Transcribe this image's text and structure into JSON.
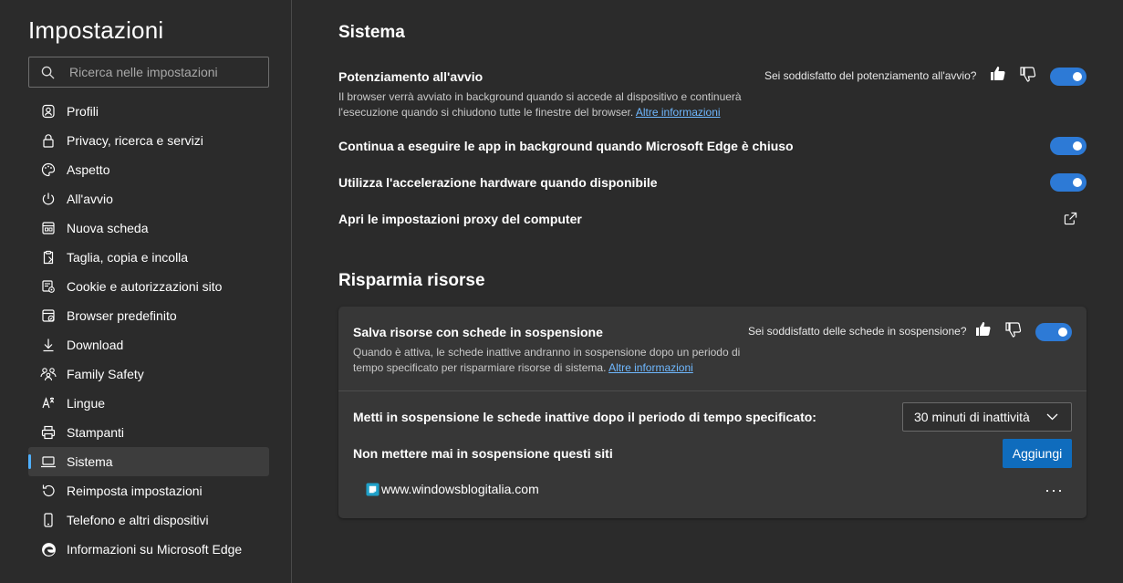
{
  "sidebar": {
    "title": "Impostazioni",
    "search_placeholder": "Ricerca nelle impostazioni",
    "items": [
      {
        "label": "Profili",
        "icon": "profile-icon"
      },
      {
        "label": "Privacy, ricerca e servizi",
        "icon": "lock-icon"
      },
      {
        "label": "Aspetto",
        "icon": "palette-icon"
      },
      {
        "label": "All'avvio",
        "icon": "power-icon"
      },
      {
        "label": "Nuova scheda",
        "icon": "new-tab-icon"
      },
      {
        "label": "Taglia, copia e incolla",
        "icon": "clipboard-icon"
      },
      {
        "label": "Cookie e autorizzazioni sito",
        "icon": "cookie-permissions-icon"
      },
      {
        "label": "Browser predefinito",
        "icon": "default-browser-icon"
      },
      {
        "label": "Download",
        "icon": "download-icon"
      },
      {
        "label": "Family Safety",
        "icon": "family-icon"
      },
      {
        "label": "Lingue",
        "icon": "language-icon"
      },
      {
        "label": "Stampanti",
        "icon": "printer-icon"
      },
      {
        "label": "Sistema",
        "icon": "laptop-icon",
        "active": true
      },
      {
        "label": "Reimposta impostazioni",
        "icon": "reset-icon"
      },
      {
        "label": "Telefono e altri dispositivi",
        "icon": "phone-icon"
      },
      {
        "label": "Informazioni su Microsoft Edge",
        "icon": "edge-icon"
      }
    ]
  },
  "system": {
    "heading": "Sistema",
    "startup_boost": {
      "title": "Potenziamento all'avvio",
      "desc1": "Il browser verrà avviato in background quando si accede al dispositivo e continuerà",
      "desc2": "l'esecuzione quando si chiudono tutte le finestre del browser.",
      "link": "Altre informazioni",
      "feedback": "Sei soddisfatto del potenziamento all'avvio?",
      "enabled": true
    },
    "background_apps": {
      "title": "Continua a eseguire le app in background quando Microsoft Edge è chiuso",
      "enabled": true
    },
    "hardware_accel": {
      "title": "Utilizza l'accelerazione hardware quando disponibile",
      "enabled": true
    },
    "proxy": {
      "title": "Apri le impostazioni proxy del computer"
    }
  },
  "resources": {
    "heading": "Risparmia risorse",
    "sleeping_tabs": {
      "title": "Salva risorse con schede in sospensione",
      "desc1": "Quando è attiva, le schede inattive andranno in sospensione dopo un periodo di",
      "desc2": "tempo specificato per risparmiare risorse di sistema.",
      "link": "Altre informazioni",
      "feedback": "Sei soddisfatto delle schede in sospensione?",
      "enabled": true
    },
    "sleep_after": {
      "label": "Metti in sospensione le schede inattive dopo il periodo di tempo specificato:",
      "selected": "30 minuti di inattività"
    },
    "never_sleep": {
      "label": "Non mettere mai in sospensione questi siti",
      "add_button": "Aggiungi"
    },
    "sites": [
      {
        "url": "www.windowsblogitalia.com"
      }
    ]
  },
  "colors": {
    "accent": "#2d7ad6",
    "link": "#6fb8ff",
    "primary_button": "#0f6cbd"
  }
}
